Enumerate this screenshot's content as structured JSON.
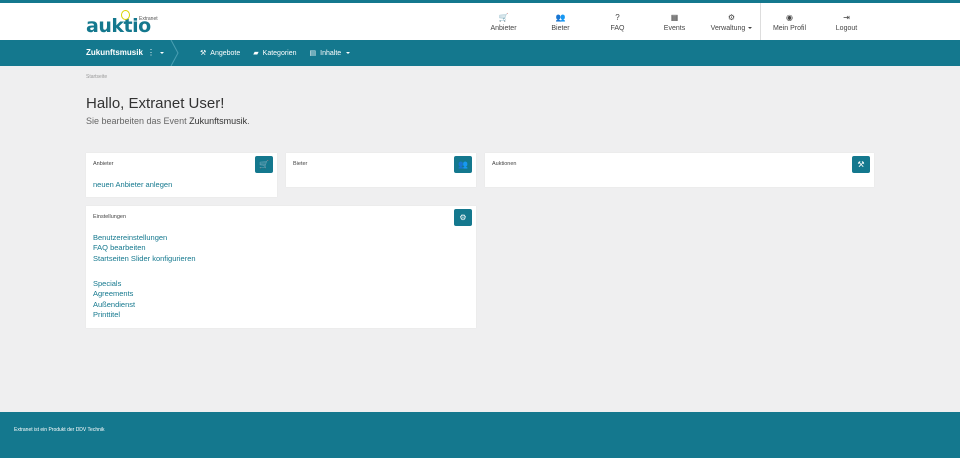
{
  "brand": {
    "name": "auktio",
    "tag": "Extranet"
  },
  "topnav": [
    {
      "icon": "🛒",
      "label": "Anbieter"
    },
    {
      "icon": "👥",
      "label": "Bieter"
    },
    {
      "icon": "?",
      "label": "FAQ"
    },
    {
      "icon": "▦",
      "label": "Events"
    },
    {
      "icon": "⚙",
      "label": "Verwaltung"
    },
    {
      "icon": "◉",
      "label": "Mein Profil"
    },
    {
      "icon": "⇥",
      "label": "Logout"
    }
  ],
  "subbar": {
    "event": "Zukunftsmusik",
    "kebab": "⋮",
    "links": [
      {
        "icon": "⚒",
        "label": "Angebote"
      },
      {
        "icon": "▰",
        "label": "Kategorien"
      },
      {
        "icon": "▤",
        "label": "Inhalte"
      }
    ]
  },
  "breadcrumb": "Startseite",
  "greeting": "Hallo, Extranet User!",
  "editing": {
    "prefix": "Sie bearbeiten das Event ",
    "event": "Zukunftsmusik",
    "suffix": "."
  },
  "cards": {
    "anbieter": {
      "title": "Anbieter",
      "icon": "🛒",
      "links": [
        "neuen Anbieter anlegen"
      ]
    },
    "bieter": {
      "title": "Bieter",
      "icon": "👥"
    },
    "auktionen": {
      "title": "Auktionen",
      "icon": "⚒"
    },
    "einstellungen": {
      "title": "Einstellungen",
      "icon": "⚙",
      "links_a": [
        "Benutzereinstellungen",
        "FAQ bearbeiten",
        "Startseiten Slider konfigurieren"
      ],
      "links_b": [
        "Specials",
        "Agreements",
        "Außendienst",
        "Printtitel"
      ]
    }
  },
  "footer": "Extranet ist ein Produkt der DDV Technik"
}
